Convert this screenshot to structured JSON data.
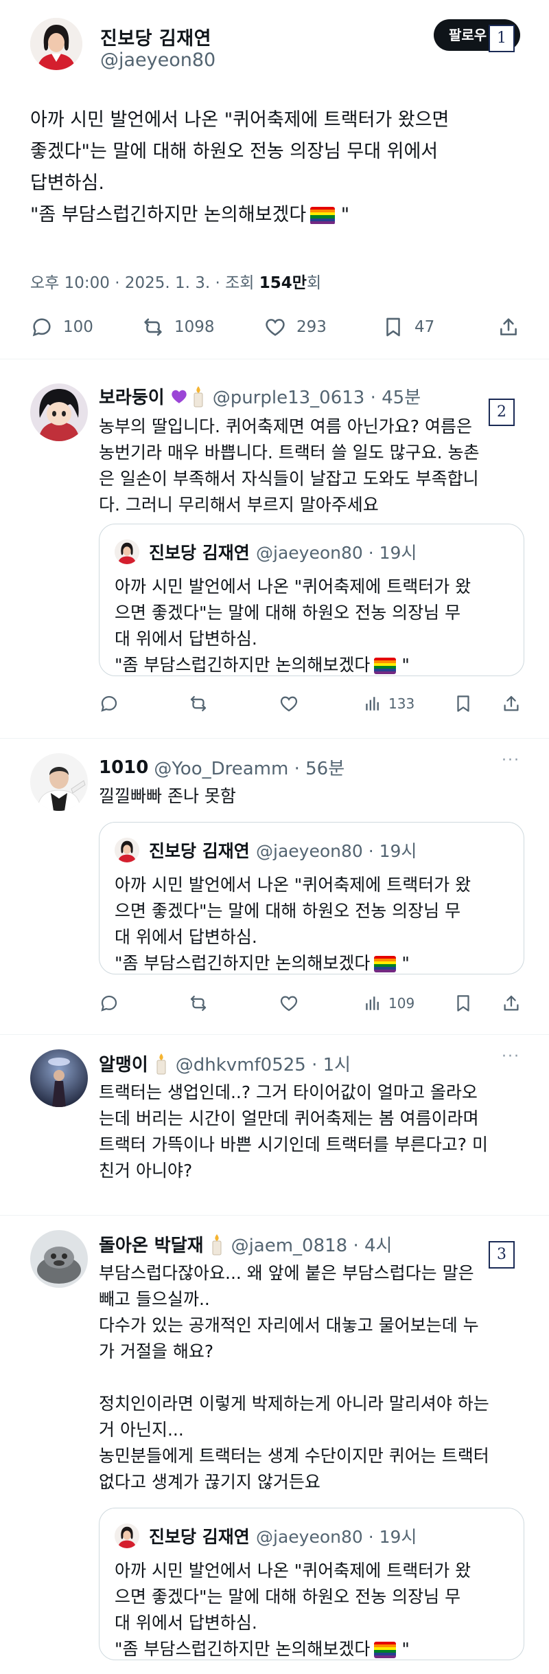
{
  "main_post": {
    "display_name": "진보당 김재연",
    "handle": "@jaeyeon80",
    "follow_label": "팔로우",
    "tag": "1",
    "text_lines": [
      "아까 시민 발언에서 나온 \"퀴어축제에 트랙터가 왔으면",
      "좋겠다\"는 말에 대해 하원오 전농 의장님 무대 위에서",
      "답변하심.",
      "\"좀 부담스럽긴하지만 논의해보겠다"
    ],
    "text_end": " \"",
    "time": "오후 10:00 · 2025. 1. 3. · 조회 ",
    "views": "154만",
    "views_suffix": "회",
    "actions": {
      "reply_icon": "reply-icon",
      "replies": "100",
      "repost_icon": "repost-icon",
      "reposts": "1098",
      "like_icon": "heart-icon",
      "likes": "293",
      "bookmark_icon": "bookmark-icon",
      "bookmarks": "47",
      "share_icon": "share-icon"
    }
  },
  "quoted_post": {
    "display_name": "진보당 김재연",
    "handle": "@jaeyeon80 · 19시",
    "text_lines": [
      "아까 시민 발언에서 나온 \"퀴어축제에 트랙터가 왔",
      "으면 좋겠다\"는 말에 대해 하원오 전농 의장님 무",
      "대 위에서 답변하심.",
      "\"좀 부담스럽긴하지만 논의해보겠다"
    ],
    "text_end": " \""
  },
  "replies": [
    {
      "name": "보라둥이",
      "handle": "@purple13_0613 · 45분",
      "tag": "2",
      "text_lines": [
        "농부의 딸입니다. 퀴어축제면 여름 아닌가요? 여름은",
        "농번기라 매우 바쁩니다. 트랙터 쓸 일도 많구요. 농촌",
        "은 일손이 부족해서 자식들이 날잡고 도와도 부족합니",
        "다. 그러니 무리해서 부르지 말아주세요"
      ],
      "views": "133"
    },
    {
      "name": "1010",
      "handle": "@Yoo_Dreamm · 56분",
      "more": "···",
      "text_lines": [
        "낄낄빠빠 존나 못함"
      ],
      "views": "109"
    },
    {
      "name": "알맹이",
      "handle": "@dhkvmf0525 · 1시",
      "more": "···",
      "text_lines": [
        "트랙터는 생업인데..? 그거 타이어값이 얼마고 올라오",
        "는데 버리는 시간이 얼만데 퀴어축제는 봄 여름이라며",
        "트랙터 가뜩이나 바쁜 시기인데 트랙터를 부른다고? 미",
        "친거 아니야?"
      ]
    },
    {
      "name": "돌아온 박달재",
      "handle": "@jaem_0818 · 4시",
      "tag": "3",
      "text_lines": [
        "부담스럽다잖아요... 왜 앞에 붙은 부담스럽다는 말은",
        "빼고 들으실까..",
        "다수가 있는 공개적인 자리에서 대놓고 물어보는데 누",
        "가 거절을 해요?",
        "",
        "정치인이라면 이렇게 박제하는게 아니라 말리셔야 하는",
        "거 아닌지...",
        "농민분들에게 트랙터는 생계 수단이지만 퀴어는 트랙터",
        "없다고 생계가 끊기지 않거든요"
      ]
    }
  ],
  "colors": {
    "text": "#0f1419",
    "secondary": "#536471",
    "follow_bg": "#0f1419",
    "border": "#cfd9de",
    "tag_border": "#1a2a55",
    "rainbow": [
      "#e40303",
      "#ff8c00",
      "#ffed00",
      "#008026",
      "#24408e",
      "#732982"
    ]
  }
}
